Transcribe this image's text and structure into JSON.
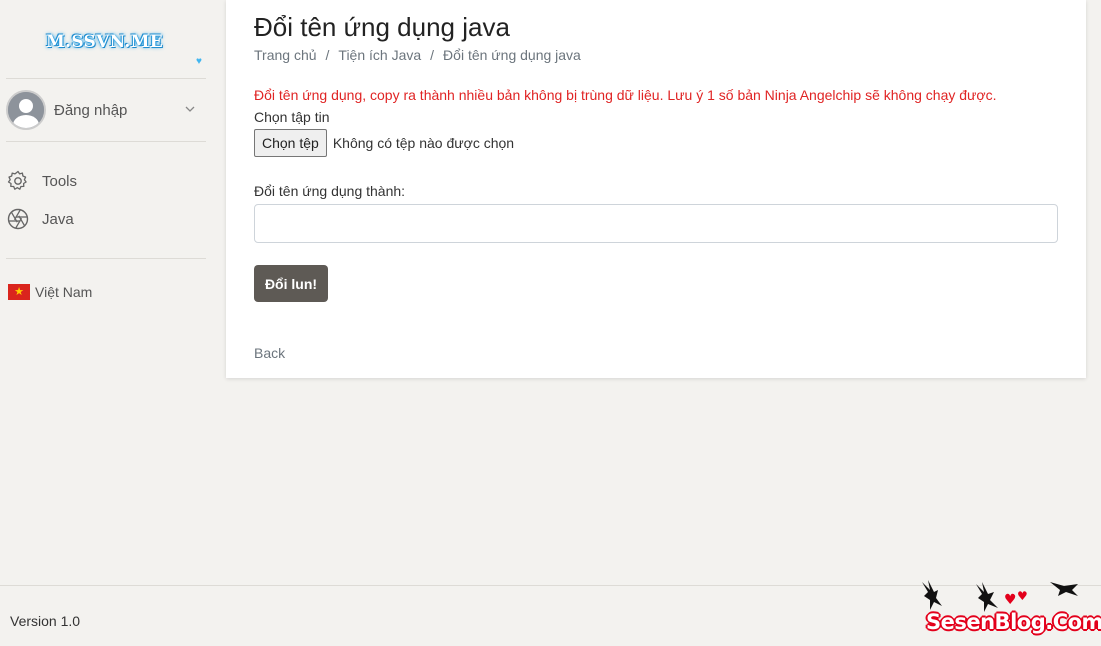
{
  "sidebar": {
    "logo_text": "M.SSVN.ME",
    "user_label": "Đăng nhập",
    "nav": [
      {
        "label": "Tools",
        "icon": "gear-icon"
      },
      {
        "label": "Java",
        "icon": "aperture-icon"
      }
    ],
    "language": "Việt Nam"
  },
  "main": {
    "title": "Đổi tên ứng dụng java",
    "breadcrumb": [
      "Trang chủ",
      "Tiện ích Java",
      "Đổi tên ứng dụng java"
    ],
    "notice": "Đổi tên ứng dụng, copy ra thành nhiều bản không bị trùng dữ liệu. Lưu ý 1 số bản Ninja Angelchip sẽ không chạy được.",
    "file_label": "Chọn tập tin",
    "file_button": "Chọn tệp",
    "file_status": "Không có tệp nào được chọn",
    "rename_label": "Đổi tên ứng dụng thành:",
    "rename_value": "",
    "submit_label": "Đổi lun!",
    "back_label": "Back"
  },
  "footer": {
    "version": "Version 1.0"
  },
  "watermark": {
    "text": "SesenBlog.Com"
  },
  "colors": {
    "notice": "#e02424",
    "submit_bg": "#5e5a55",
    "page_bg": "#f3f2ef"
  }
}
